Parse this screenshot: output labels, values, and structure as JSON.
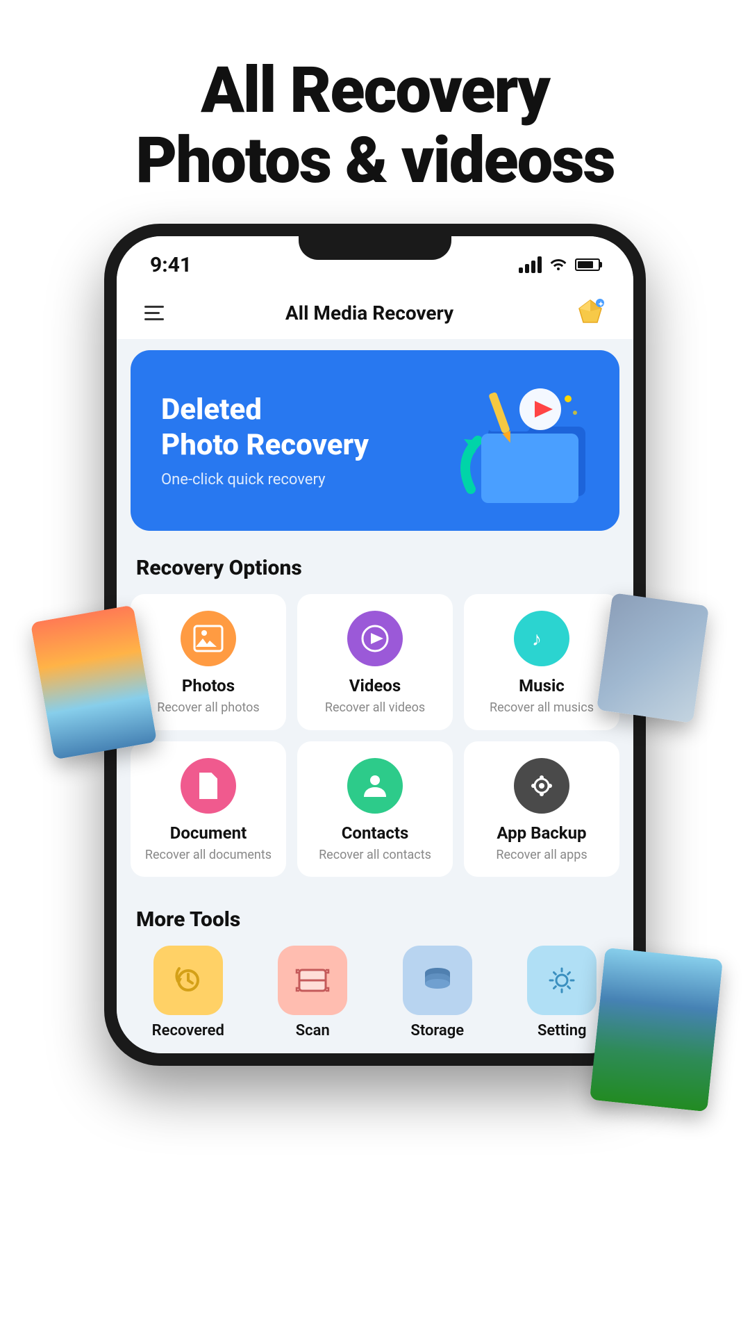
{
  "page": {
    "title_line1": "All Recovery",
    "title_line2": "Photos & videoss"
  },
  "status_bar": {
    "time": "9:41",
    "signal": "signal-icon",
    "wifi": "wifi-icon",
    "battery": "battery-icon"
  },
  "app_header": {
    "menu_icon": "menu-icon",
    "title": "All Media Recovery",
    "action_icon": "sketch-icon"
  },
  "hero": {
    "title_line1": "Deleted",
    "title_line2": "Photo Recovery",
    "subtitle": "One-click quick recovery"
  },
  "recovery_options": {
    "section_title": "Recovery Options",
    "items": [
      {
        "label": "Photos",
        "sublabel": "Recover all photos",
        "icon": "photo-icon",
        "color": "orange"
      },
      {
        "label": "Videos",
        "sublabel": "Recover all videos",
        "icon": "video-icon",
        "color": "purple"
      },
      {
        "label": "Music",
        "sublabel": "Recover all musics",
        "icon": "music-icon",
        "color": "cyan"
      },
      {
        "label": "Document",
        "sublabel": "Recover all documents",
        "icon": "document-icon",
        "color": "pink"
      },
      {
        "label": "Contacts",
        "sublabel": "Recover all contacts",
        "icon": "contacts-icon",
        "color": "green"
      },
      {
        "label": "App Backup",
        "sublabel": "Recover all apps",
        "icon": "app-icon",
        "color": "gray"
      }
    ]
  },
  "more_tools": {
    "section_title": "More Tools",
    "items": [
      {
        "label": "Recovered",
        "icon": "recovered-icon",
        "color": "yellow"
      },
      {
        "label": "Scan",
        "icon": "scan-icon",
        "color": "salmon"
      },
      {
        "label": "Storage",
        "icon": "storage-icon",
        "color": "blue-light"
      },
      {
        "label": "Setting",
        "icon": "setting-icon",
        "color": "sky"
      }
    ]
  }
}
